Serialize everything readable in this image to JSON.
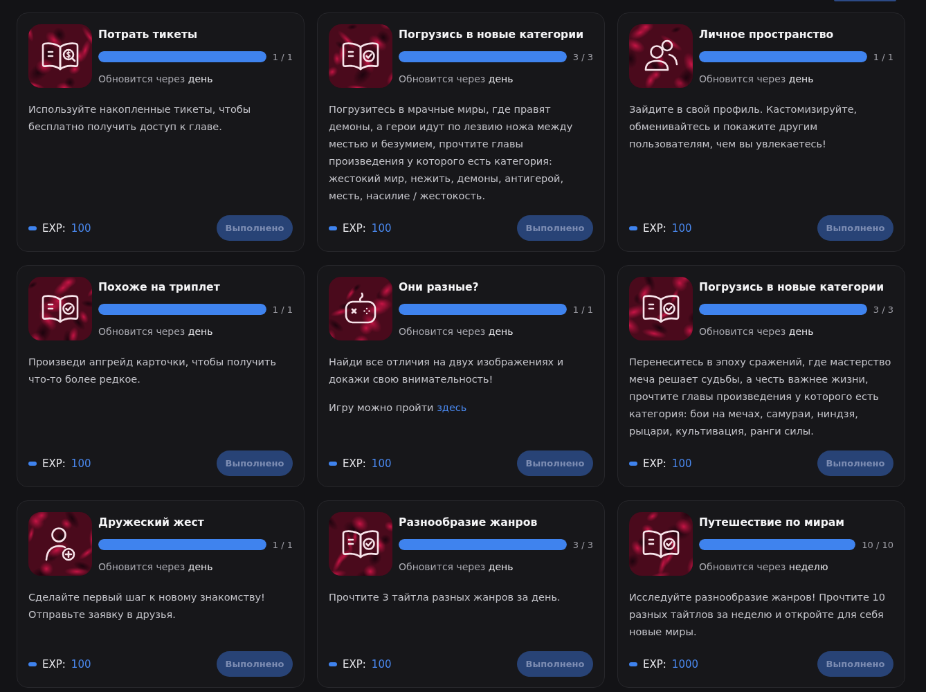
{
  "quests": [
    {
      "kind": "tickets",
      "title": "Потрать тикеты",
      "progress": {
        "level": 1,
        "text": "1 / 1"
      },
      "refresh": "Обновится через **день**",
      "description": "Используйте накопленные тикеты, чтобы бесплатно получить доступ к главе.",
      "exp": {
        "label": "EXP:",
        "value": "100"
      },
      "button": {
        "label": "Выполнено",
        "disabled": true
      }
    },
    {
      "kind": "reading",
      "title": "Погрузись в новые категории",
      "progress": {
        "level": 1,
        "text": "3 / 3"
      },
      "refresh": "Обновится через **день**",
      "description": "Погрузитесь в мрачные миры, где правят демоны, а герои идут по лезвию ножа между местью и безумием, прочтите главы произведения у которого есть категория: жестокий мир, нежить, демоны, антигерой, месть, насилие / жестокость.",
      "exp": {
        "label": "EXP:",
        "value": "100"
      },
      "button": {
        "label": "Выполнено",
        "disabled": true
      }
    },
    {
      "kind": "profile",
      "title": "Личное пространство",
      "progress": {
        "level": 1,
        "text": "1 / 1"
      },
      "refresh": "Обновится через **день**",
      "description": "Зайдите в свой профиль. Кастомизируйте, обменивайтесь и покажите другим пользователям, чем вы увлекаетесь!",
      "exp": {
        "label": "EXP:",
        "value": "100"
      },
      "button": {
        "label": "Выполнено",
        "disabled": true
      }
    },
    {
      "kind": "reading",
      "title": "Похоже на триплет",
      "progress": {
        "level": 1,
        "text": "1 / 1"
      },
      "refresh": "Обновится через **день**",
      "description": "Произведи апгрейд карточки, чтобы получить что-то более редкое.",
      "exp": {
        "label": "EXP:",
        "value": "100"
      },
      "button": {
        "label": "Выполнено",
        "disabled": true
      }
    },
    {
      "kind": "game",
      "title": "Они разные?",
      "progress": {
        "level": 1,
        "text": "1 / 1"
      },
      "refresh": "Обновится через **день**",
      "description": "Найди все отличия на двух изображениях и докажи свою внимательность!",
      "note": {
        "text": "Игру можно пройти",
        "link": "здесь"
      },
      "exp": {
        "label": "EXP:",
        "value": "100"
      },
      "button": {
        "label": "Выполнено",
        "disabled": true
      }
    },
    {
      "kind": "reading",
      "title": "Погрузись в новые категории",
      "progress": {
        "level": 1,
        "text": "3 / 3"
      },
      "refresh": "Обновится через **день**",
      "description": "Перенеситесь в эпоху сражений, где мастерство меча решает судьбы, а честь важнее жизни, прочтите главы произведения у которого есть категория: бои на мечах, самураи, ниндзя, рыцари, культивация, ранги силы.",
      "exp": {
        "label": "EXP:",
        "value": "100"
      },
      "button": {
        "label": "Выполнено",
        "disabled": true
      }
    },
    {
      "kind": "friend",
      "title": "Дружеский жест",
      "progress": {
        "level": 1,
        "text": "1 / 1"
      },
      "refresh": "Обновится через **день**",
      "description": "Сделайте первый шаг к новому знакомству! Отправьте заявку в друзья.",
      "exp": {
        "label": "EXP:",
        "value": "100"
      },
      "button": {
        "label": "Выполнено",
        "disabled": true
      }
    },
    {
      "kind": "reading",
      "title": "Разнообразие жанров",
      "progress": {
        "level": 1,
        "text": "3 / 3"
      },
      "refresh": "Обновится через **день**",
      "description": "Прочтите 3 тайтла разных жанров за день.",
      "exp": {
        "label": "EXP:",
        "value": "100"
      },
      "button": {
        "label": "Выполнено",
        "disabled": true
      }
    },
    {
      "kind": "reading",
      "title": "Путешествие по мирам",
      "progress": {
        "level": 1,
        "text": "10 / 10"
      },
      "refresh": "Обновится через **неделю**",
      "description": "Исследуйте разнообразие жанров! Прочтите 10 разных тайтлов за неделю и откройте для себя новые миры.",
      "exp": {
        "label": "EXP:",
        "value": "1000"
      },
      "button": {
        "label": "Выполнено",
        "disabled": true
      }
    }
  ]
}
